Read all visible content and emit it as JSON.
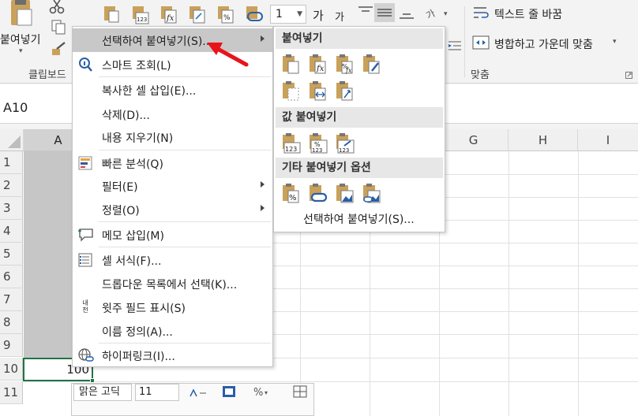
{
  "ribbon": {
    "paste_label": "붙여넣기",
    "clipboard_group": "클립보드",
    "font_size": "1",
    "grow_font_glyph": "가",
    "shrink_font_glyph": "가",
    "wrap_text": "텍스트 줄 바꿈",
    "merge_center": "병합하고 가운데 맞춤",
    "alignment_group": "맞춤"
  },
  "name_box": "A10",
  "grid": {
    "columns": [
      "A",
      "G",
      "H",
      "I"
    ],
    "rows": [
      "1",
      "2",
      "3",
      "4",
      "5",
      "6",
      "7",
      "8",
      "9",
      "10",
      "11"
    ],
    "a10_value": "100"
  },
  "mini_toolbar": {
    "font_name": "맑은 고딕",
    "font_size": "11"
  },
  "context_menu": {
    "items": [
      {
        "label": "선택하여 붙여넣기(S)...",
        "has_submenu": true,
        "highlighted": true
      },
      {
        "label": "스마트 조회(L)",
        "icon": "smart-lookup-icon"
      },
      {
        "label": "복사한 셀 삽입(E)..."
      },
      {
        "label": "삭제(D)..."
      },
      {
        "label": "내용 지우기(N)"
      },
      {
        "label": "빠른 분석(Q)",
        "icon": "quick-analysis-icon"
      },
      {
        "label": "필터(E)",
        "has_submenu": true
      },
      {
        "label": "정렬(O)",
        "has_submenu": true
      },
      {
        "label": "메모 삽입(M)",
        "icon": "insert-comment-icon"
      },
      {
        "label": "셀 서식(F)...",
        "icon": "format-cells-icon"
      },
      {
        "label": "드롭다운 목록에서 선택(K)..."
      },
      {
        "label": "윗주 필드 표시(S)",
        "icon": "phonetic-field-icon",
        "icon_text": "내천"
      },
      {
        "label": "이름 정의(A)..."
      },
      {
        "label": "하이퍼링크(I)...",
        "icon": "hyperlink-icon"
      }
    ]
  },
  "paste_submenu": {
    "paste_header": "붙여넣기",
    "values_header": "값 붙여넣기",
    "other_header": "기타 붙여넣기 옵션",
    "footer": "선택하여 붙여넣기(S)...",
    "value_badge": "123",
    "percent_glyph": "%",
    "fx_glyph": "fx"
  },
  "colors": {
    "accent_green": "#217346",
    "menu_highlight": "#c8c8c8",
    "annotation_red": "#e8141b",
    "clipboard_tan": "#c9a15a"
  }
}
